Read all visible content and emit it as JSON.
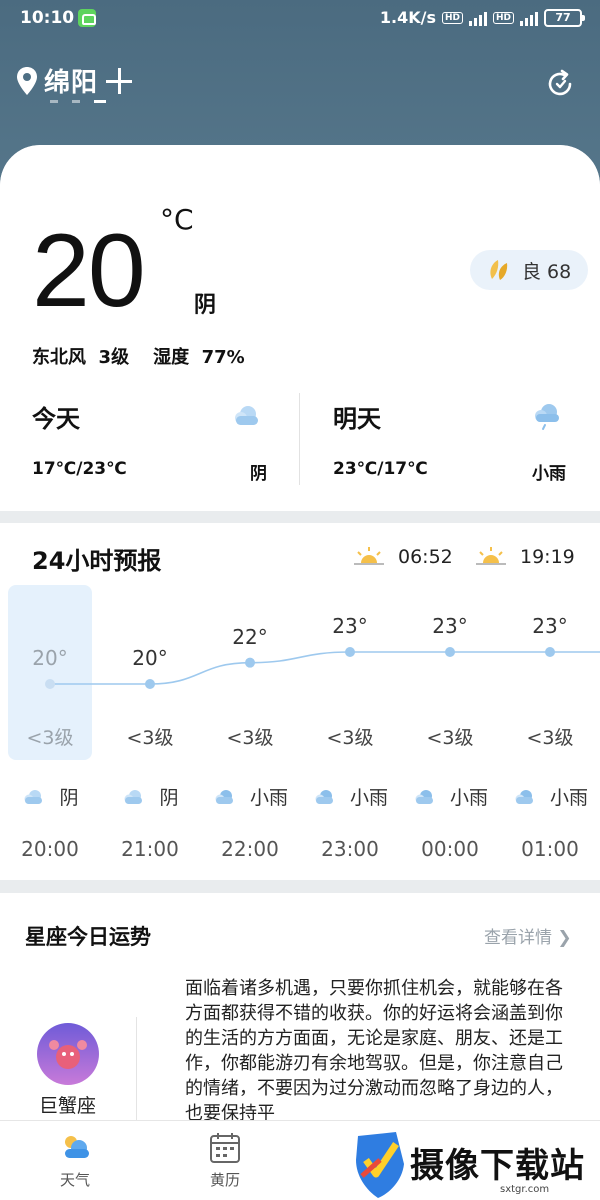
{
  "status_bar": {
    "time": "10:10",
    "network_speed": "1.4K/s",
    "hd1": "HD",
    "signal1_label": "4G",
    "hd2": "HD",
    "signal2_label": "4G",
    "battery": "77"
  },
  "header": {
    "city": "绵阳",
    "page_count": 3,
    "active_page": 3
  },
  "current": {
    "temperature": "20",
    "unit": "°C",
    "condition": "阴",
    "wind_dir": "东北风",
    "wind_level": "3级",
    "humidity_label": "湿度",
    "humidity": "77%",
    "aqi_text": "良 68"
  },
  "today": {
    "title": "今天",
    "range": "17℃/23℃",
    "condition": "阴"
  },
  "tomorrow": {
    "title": "明天",
    "range": "23℃/17℃",
    "condition": "小雨"
  },
  "hourly": {
    "title": "24小时预报",
    "sunrise": "06:52",
    "sunset": "19:19",
    "hours": [
      {
        "temp": "20°",
        "wind": "<3级",
        "cond": "阴",
        "time": "20:00"
      },
      {
        "temp": "20°",
        "wind": "<3级",
        "cond": "阴",
        "time": "21:00"
      },
      {
        "temp": "22°",
        "wind": "<3级",
        "cond": "小雨",
        "time": "22:00"
      },
      {
        "temp": "23°",
        "wind": "<3级",
        "cond": "小雨",
        "time": "23:00"
      },
      {
        "temp": "23°",
        "wind": "<3级",
        "cond": "小雨",
        "time": "00:00"
      },
      {
        "temp": "23°",
        "wind": "<3级",
        "cond": "小雨",
        "time": "01:00"
      }
    ]
  },
  "horoscope": {
    "title": "星座今日运势",
    "more": "查看详情",
    "sign": "巨蟹座",
    "text": "面临着诸多机遇，只要你抓住机会，就能够在各方面都获得不错的收获。你的好运将会涵盖到你的生活的方方面面，无论是家庭、朋友、还是工作，你都能游刃有余地驾驭。但是，你注意自己的情绪，不要因为过分激动而忽略了身边的人，也要保持平"
  },
  "nav": {
    "weather": "天气",
    "calendar": "黄历"
  },
  "watermark": {
    "text": "摄像下载站",
    "url": "sxtgr.com"
  },
  "colors": {
    "header_bg": "#4e6f84",
    "accent_blue": "#9ec9ee",
    "highlight": "#e5f1fc"
  }
}
